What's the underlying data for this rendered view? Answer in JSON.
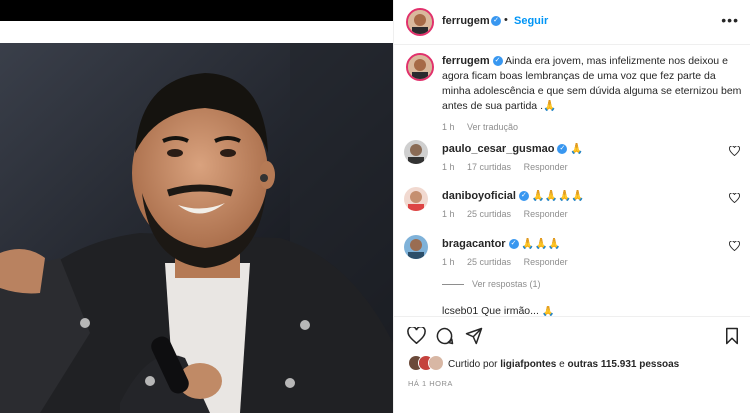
{
  "post": {
    "username": "ferrugem",
    "follow_label": "Seguir",
    "more_label": "•••",
    "caption": "Ainda era jovem, mas infelizmente nos deixou e agora ficam boas lembranças de uma voz que fez parte da minha adolescência e que sem dúvida alguma se eternizou bem antes de sua partida .🙏",
    "caption_time": "1 h",
    "translate_label": "Ver tradução"
  },
  "comments": [
    {
      "username": "paulo_cesar_gusmao",
      "text": "🙏",
      "time": "1 h",
      "likes": "17 curtidas",
      "reply": "Responder"
    },
    {
      "username": "daniboyoficial",
      "text": "🙏🙏🙏🙏",
      "time": "1 h",
      "likes": "25 curtidas",
      "reply": "Responder"
    },
    {
      "username": "bragacantor",
      "text": "🙏🙏🙏",
      "time": "1 h",
      "likes": "25 curtidas",
      "reply": "Responder"
    }
  ],
  "view_replies_label": "Ver respostas (1)",
  "partial_comment": "lcseb01 Que irmão... 🙏",
  "likes": {
    "prefix": "Curtido por",
    "user": "ligiafpontes",
    "middle": "e",
    "others": "outras 115.931 pessoas"
  },
  "post_time": "HÁ 1 HORA",
  "icons": [
    "heart-icon",
    "comment-icon",
    "share-icon",
    "bookmark-icon",
    "more-icon",
    "verified-icon"
  ],
  "colors": {
    "accent": "#0095f6",
    "verified": "#3897f0",
    "muted": "#8e8e8e"
  }
}
